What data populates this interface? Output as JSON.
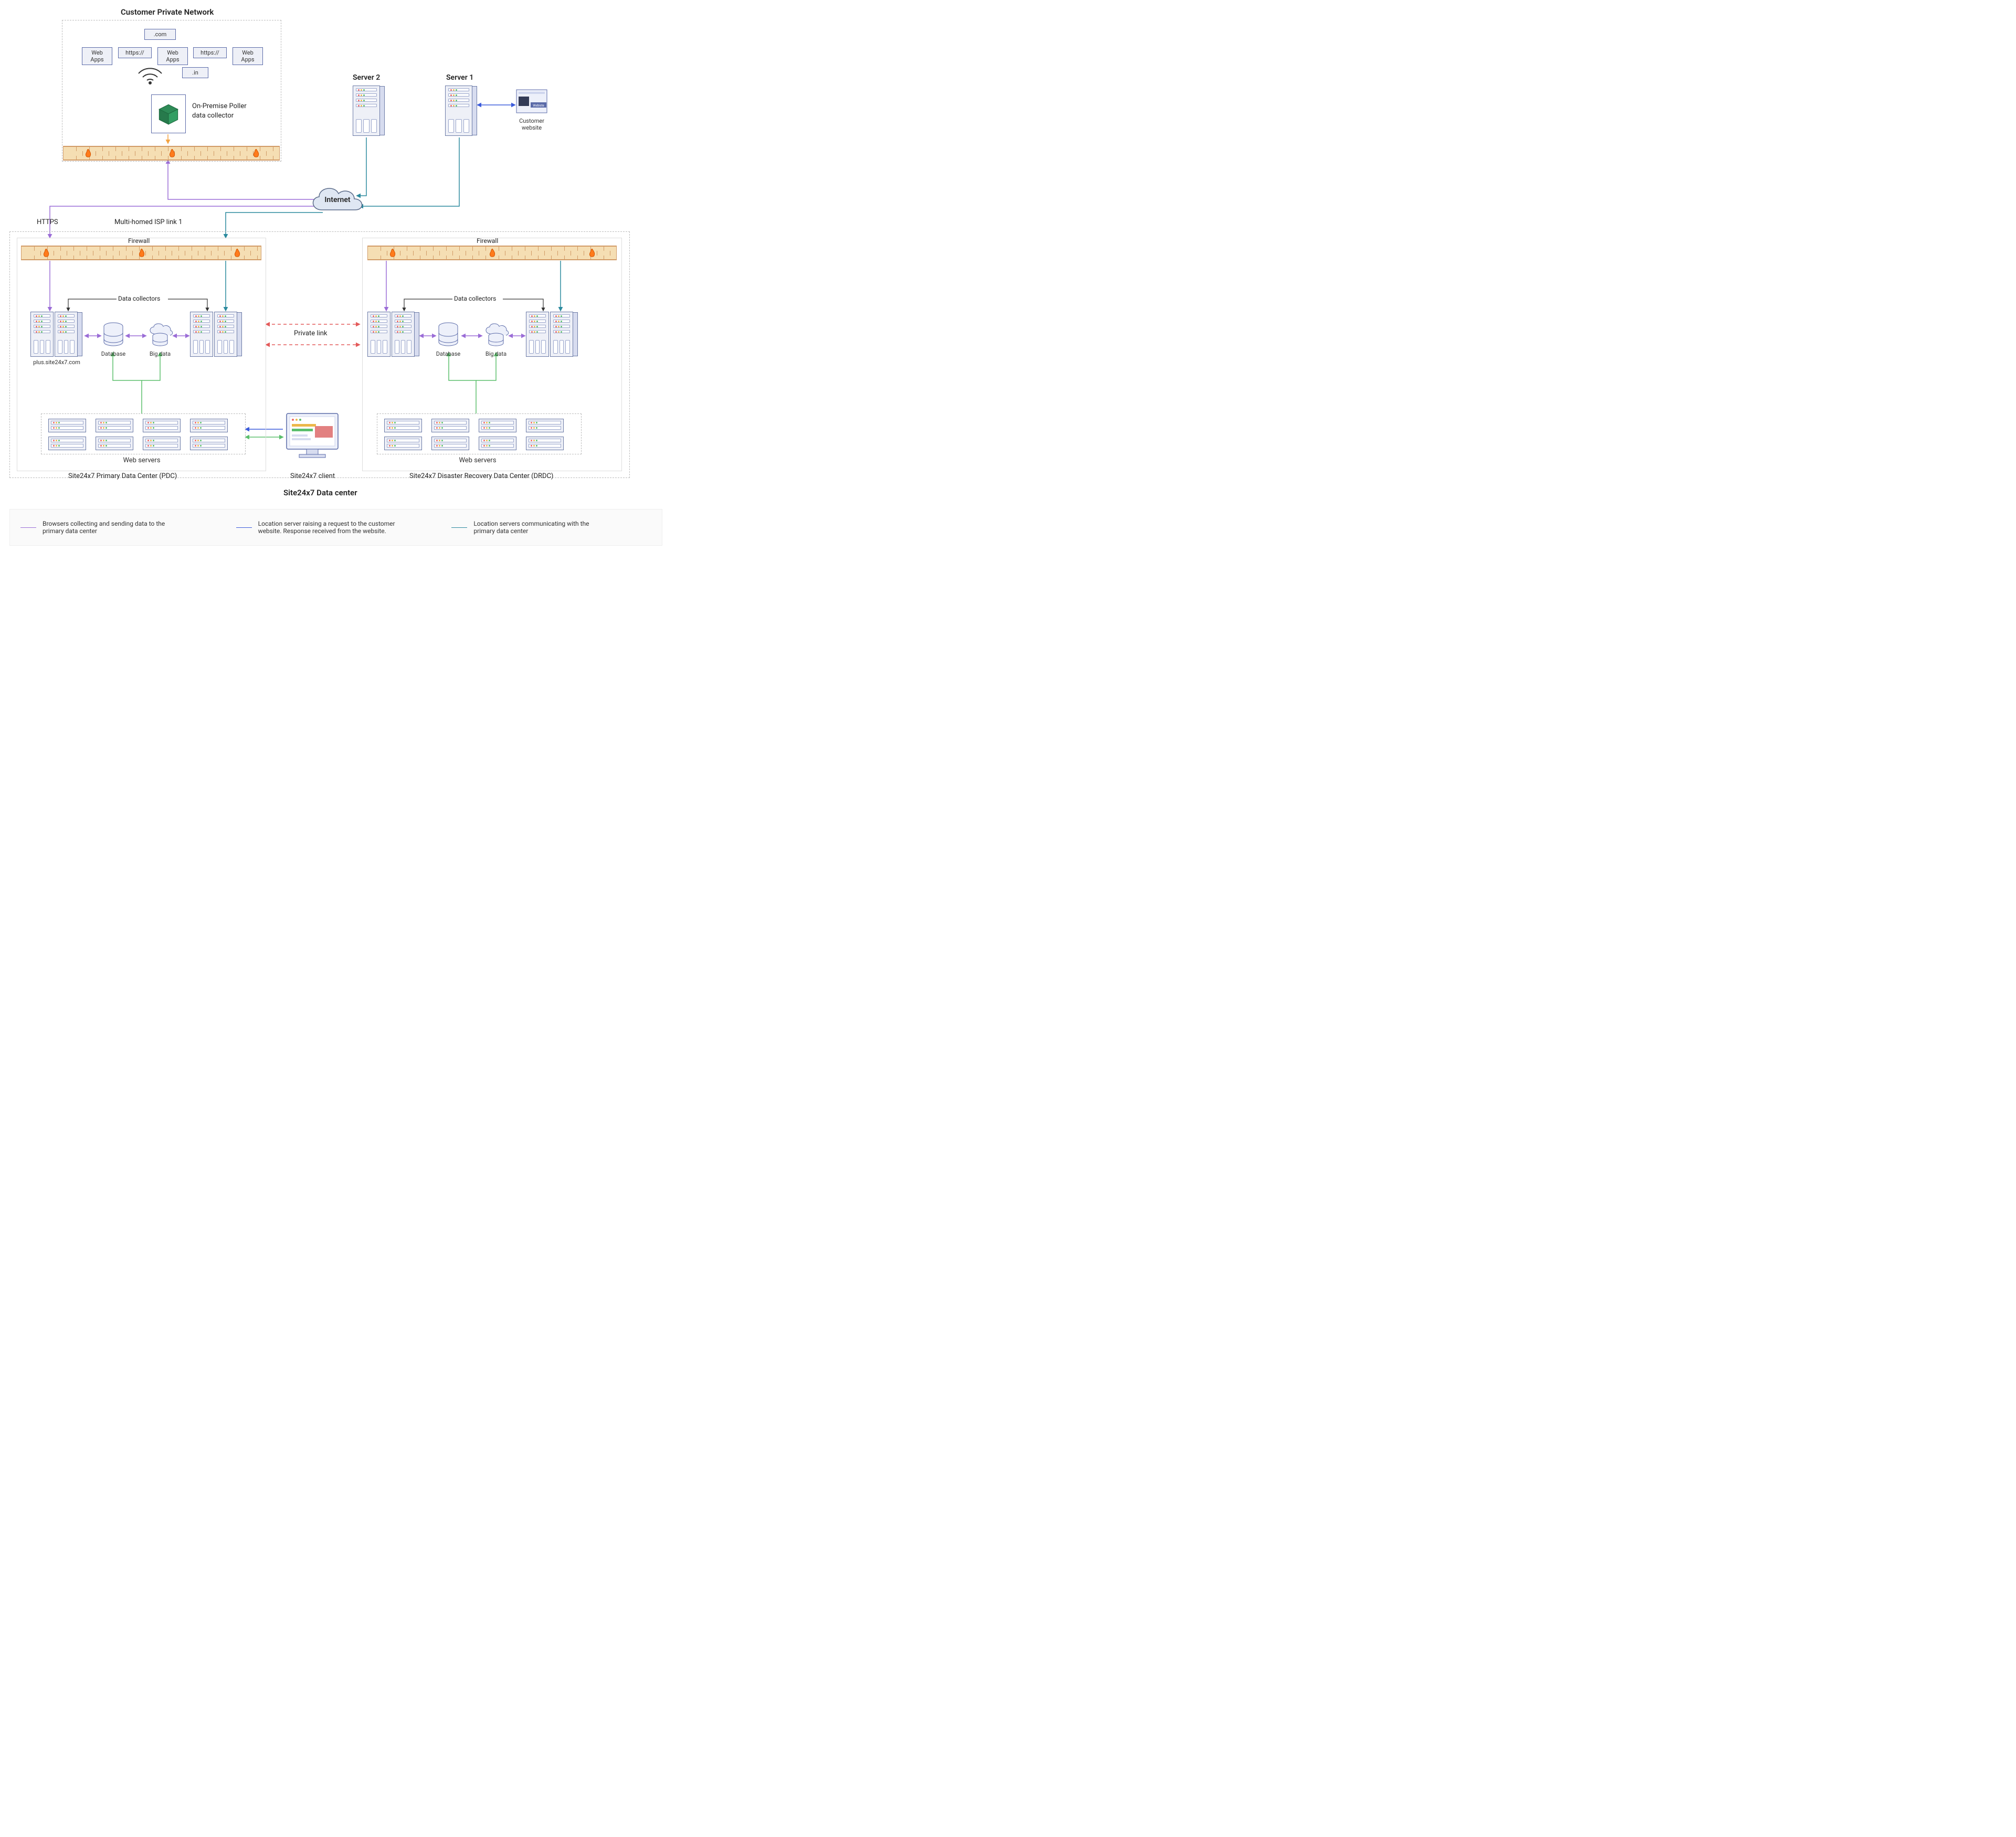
{
  "customer_network": {
    "title": "Customer Private Network",
    "chips": {
      "com": ".com",
      "in": ".in",
      "https1": "https://",
      "https2": "https://",
      "webapps1": "Web Apps",
      "webapps2": "Web Apps",
      "webapps3": "Web Apps"
    },
    "poller": {
      "line1": "On-Premise Poller",
      "line2": "data collector"
    }
  },
  "servers": {
    "server1": "Server 1",
    "server2": "Server 2",
    "customer_website": "Customer\nwebsite",
    "website_badge": "Webiste"
  },
  "internet": "Internet",
  "links": {
    "https": "HTTPS",
    "multihomed": "Multi-homed ISP link 1",
    "private_link": "Private link"
  },
  "datacenter": {
    "pdc_title": "Site24x7 Primary Data Center (PDC)",
    "drdc_title": "Site24x7 Disaster Recovery Data Center (DRDC)",
    "firewall": "Firewall",
    "data_collectors": "Data collectors",
    "database": "Database",
    "bigdata": "Big data",
    "plus_site": "plus.site24x7.com",
    "web_servers": "Web servers",
    "client": "Site24x7 client",
    "overall": "Site24x7 Data center"
  },
  "legend": {
    "purple": "Browsers collecting and sending data to the primary data center",
    "blue": "Location server raising a request to the customer website. Response received from the website.",
    "teal": "Location servers communicating with the primary data center"
  },
  "colors": {
    "purple": "#9b6dd7",
    "blue": "#3b5bdb",
    "teal": "#2b8a9e",
    "green": "#5bbf6c",
    "orange": "#f4a340",
    "red": "#e45b5b"
  }
}
